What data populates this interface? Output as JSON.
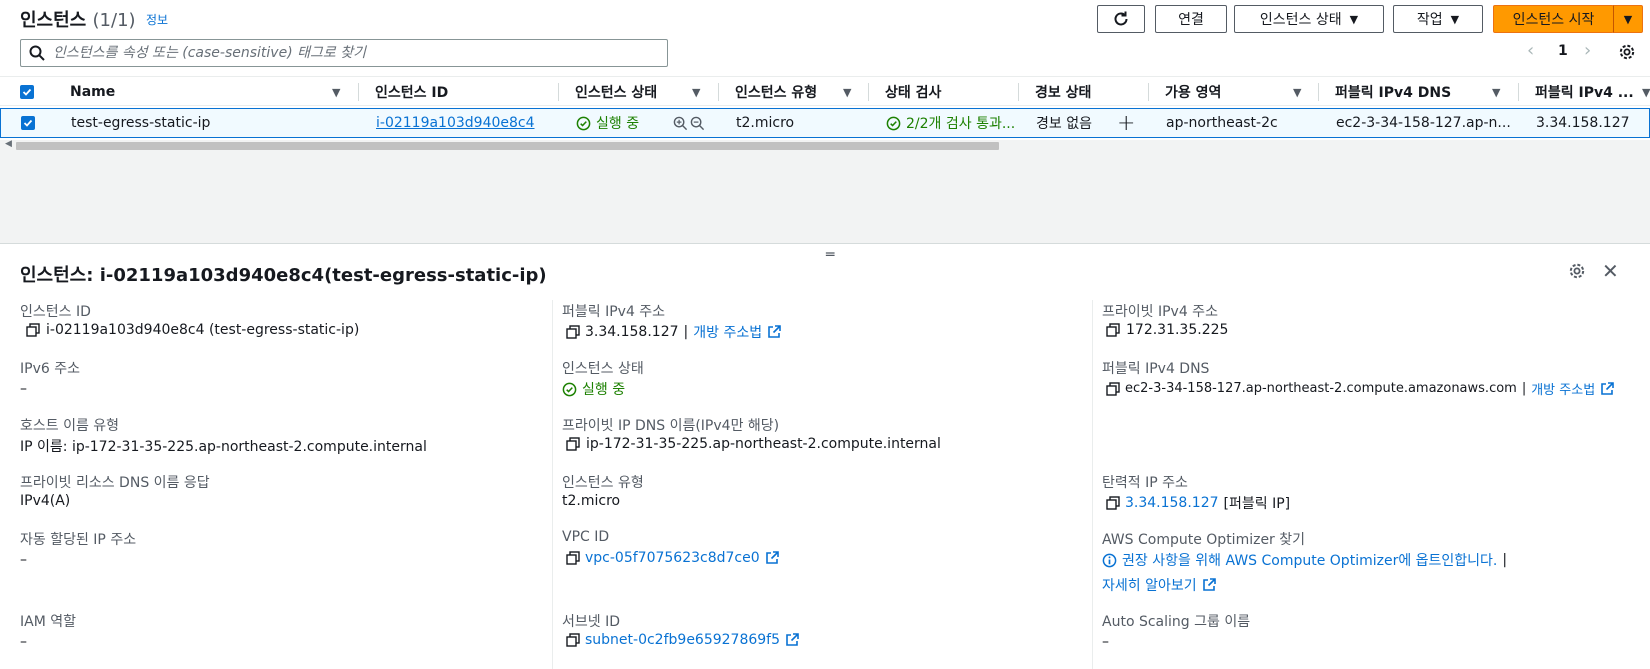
{
  "header": {
    "title": "인스턴스",
    "count": "(1/1)",
    "info_link": "정보",
    "refresh_label": "",
    "connect_label": "연결",
    "instance_state_label": "인스턴스 상태",
    "actions_label": "작업",
    "launch_label": "인스턴스 시작"
  },
  "search": {
    "placeholder": "인스턴스를 속성 또는 (case-sensitive) 태그로 찾기"
  },
  "pagination": {
    "page": "1"
  },
  "table": {
    "columns": [
      "Name",
      "인스턴스 ID",
      "인스턴스 상태",
      "인스턴스 유형",
      "상태 검사",
      "경보 상태",
      "가용 영역",
      "퍼블릭 IPv4 DNS",
      "퍼블릭 IPv4 ..."
    ],
    "row": {
      "name": "test-egress-static-ip",
      "instance_id": "i-02119a103d940e8c4",
      "state": "실행 중",
      "type": "t2.micro",
      "status_check": "2/2개 검사 통과...",
      "alarm": "경보 없음",
      "az": "ap-northeast-2c",
      "public_dns": "ec2-3-34-158-127.ap-n...",
      "public_ip": "3.34.158.127"
    }
  },
  "details": {
    "title": "인스턴스: i-02119a103d940e8c4(test-egress-static-ip)",
    "col1": {
      "instance_id_label": "인스턴스 ID",
      "instance_id_value": "i-02119a103d940e8c4 (test-egress-static-ip)",
      "ipv6_label": "IPv6 주소",
      "ipv6_value": "–",
      "hostname_type_label": "호스트 이름 유형",
      "hostname_type_value": "IP 이름: ip-172-31-35-225.ap-northeast-2.compute.internal",
      "private_dns_resp_label": "프라이빗 리소스 DNS 이름 응답",
      "private_dns_resp_value": "IPv4(A)",
      "auto_ip_label": "자동 할당된 IP 주소",
      "auto_ip_value": "–",
      "iam_label": "IAM 역할",
      "iam_value": "–"
    },
    "col2": {
      "public_ipv4_label": "퍼블릭 IPv4 주소",
      "public_ipv4_value": "3.34.158.127",
      "public_ipv4_sep": "|",
      "open_address_link": "개방 주소법",
      "state_label": "인스턴스 상태",
      "state_value": "실행 중",
      "private_ip_dns_label": "프라이빗 IP DNS 이름(IPv4만 해당)",
      "private_ip_dns_value": "ip-172-31-35-225.ap-northeast-2.compute.internal",
      "type_label": "인스턴스 유형",
      "type_value": "t2.micro",
      "vpc_label": "VPC ID",
      "vpc_value": "vpc-05f7075623c8d7ce0",
      "subnet_label": "서브넷 ID",
      "subnet_value": "subnet-0c2fb9e65927869f5"
    },
    "col3": {
      "private_ipv4_label": "프라이빗 IPv4 주소",
      "private_ipv4_value": "172.31.35.225",
      "public_dns_label": "퍼블릭 IPv4 DNS",
      "public_dns_value": "ec2-3-34-158-127.ap-northeast-2.compute.amazonaws.com",
      "public_dns_sep": "|",
      "open_address_link": "개방 주소법",
      "eip_label": "탄력적 IP 주소",
      "eip_value": "3.34.158.127",
      "eip_suffix": "[퍼블릭 IP]",
      "optimizer_label": "AWS Compute Optimizer 찾기",
      "optimizer_value": "권장 사항을 위해 AWS Compute Optimizer에 옵트인합니다.",
      "optimizer_sep": "|",
      "learn_more": "자세히 알아보기",
      "asg_label": "Auto Scaling 그룹 이름",
      "asg_value": "–"
    }
  },
  "colors": {
    "primary": "#ff9900",
    "link": "#0972d3",
    "success": "#1d8102",
    "selected_row": "#f1faff"
  }
}
